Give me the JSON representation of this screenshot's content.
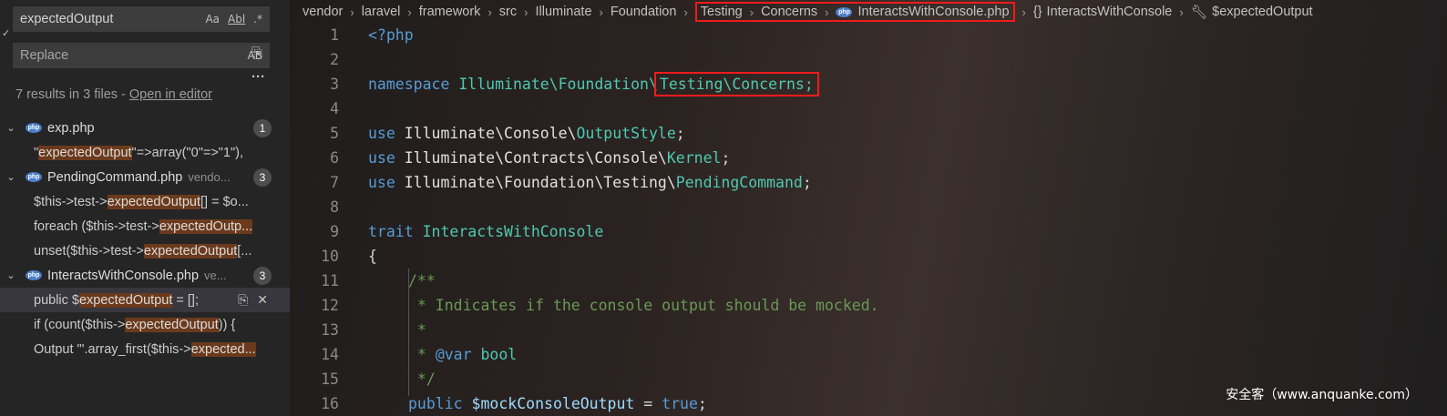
{
  "search": {
    "query": "expectedOutput",
    "replace_placeholder": "Replace",
    "opt_case": "Aa",
    "opt_word": "Abl",
    "opt_regex": ".*",
    "opt_preserve_case": "AB",
    "summary": "7 results in 3 files -",
    "open_in_editor": "Open in editor"
  },
  "results": [
    {
      "file": "exp.php",
      "path": "",
      "count": "1",
      "matches": [
        {
          "pre": "\"",
          "hit": "expectedOutput",
          "post": "\"=>array(\"0\"=>\"1\"),"
        }
      ]
    },
    {
      "file": "PendingCommand.php",
      "path": "vendo...",
      "count": "3",
      "matches": [
        {
          "pre": "$this->test->",
          "hit": "expectedOutput",
          "post": "[] = $o..."
        },
        {
          "pre": "foreach ($this->test->",
          "hit": "expectedOutp...",
          "post": ""
        },
        {
          "pre": "unset($this->test->",
          "hit": "expectedOutput",
          "post": "[..."
        }
      ]
    },
    {
      "file": "InteractsWithConsole.php",
      "path": "ve...",
      "count": "3",
      "matches": [
        {
          "pre": "public $",
          "hit": "expectedOutput",
          "post": " = [];"
        },
        {
          "pre": "if (count($this->",
          "hit": "expectedOutput",
          "post": ")) {"
        },
        {
          "pre": "Output \"'.array_first($this->",
          "hit": "expected...",
          "post": ""
        }
      ]
    }
  ],
  "breadcrumb": {
    "parts": [
      "vendor",
      "laravel",
      "framework",
      "src",
      "Illuminate",
      "Foundation"
    ],
    "boxed": [
      "Testing",
      "Concerns"
    ],
    "file": "InteractsWithConsole.php",
    "symbol_icon": "{}",
    "symbol": "InteractsWithConsole",
    "member": "$expectedOutput"
  },
  "code": {
    "line_numbers": [
      "1",
      "2",
      "3",
      "4",
      "5",
      "6",
      "7",
      "8",
      "9",
      "10",
      "11",
      "12",
      "13",
      "14",
      "15",
      "16"
    ],
    "l1": "<?php",
    "l3_kw": "namespace",
    "l3_ns": "Illuminate\\Foundation\\",
    "l3_box": "Testing\\Concerns;",
    "l5_kw": "use",
    "l5_ns": "Illuminate\\Console\\",
    "l5_cls": "OutputStyle",
    "l5_end": ";",
    "l6_kw": "use",
    "l6_ns": "Illuminate\\Contracts\\Console\\",
    "l6_cls": "Kernel",
    "l6_end": ";",
    "l7_kw": "use",
    "l7_ns": "Illuminate\\Foundation\\Testing\\",
    "l7_cls": "PendingCommand",
    "l7_end": ";",
    "l9_kw": "trait",
    "l9_cls": "InteractsWithConsole",
    "l10": "{",
    "l11": "/**",
    "l12": " * Indicates if the console output should be mocked.",
    "l13": " *",
    "l14_pre": " * ",
    "l14_tag": "@var",
    "l14_type": "bool",
    "l15": " */",
    "l16_kw": "public",
    "l16_var": "$mockConsoleOutput",
    "l16_op": " = ",
    "l16_val": "true",
    "l16_end": ";"
  },
  "watermark": "安全客（www.anquanke.com）"
}
